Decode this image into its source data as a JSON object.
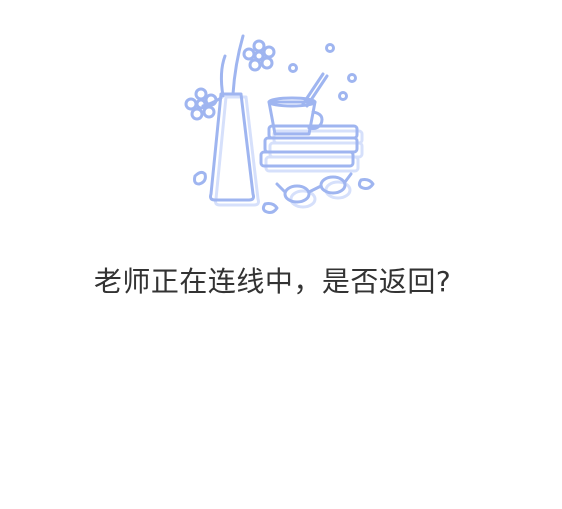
{
  "dialog": {
    "message": "老师正在连线中，是否返回?",
    "illustration_icon": "vase-flowers-cup-books-glasses-icon",
    "colors": {
      "illustration_stroke": "#9fb5f0",
      "illustration_shadow": "#d6e0fb",
      "text": "#333333",
      "background": "#ffffff"
    }
  }
}
